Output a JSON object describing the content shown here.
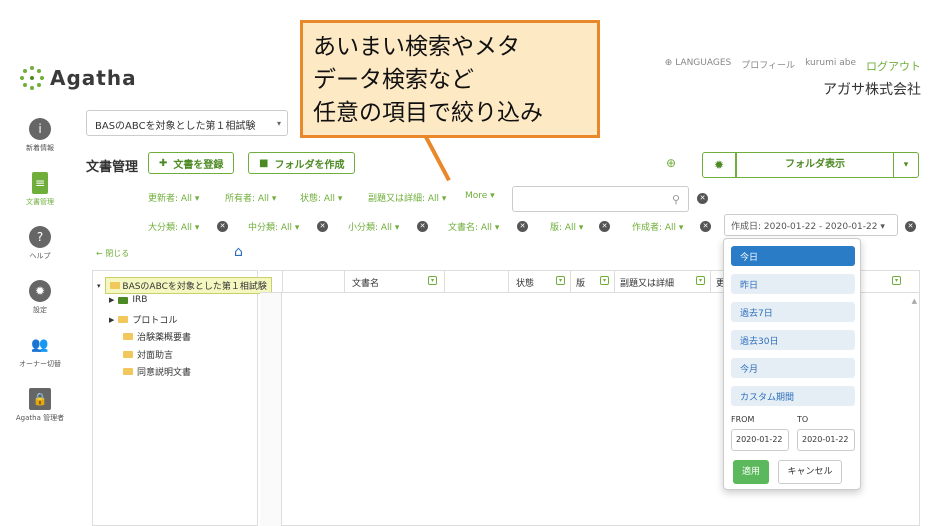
{
  "app": {
    "logo_text": "Agatha",
    "company": "アガサ株式会社"
  },
  "header": {
    "languages": "LANGUAGES",
    "profile": "プロフィール",
    "user": "kurumi abe",
    "logout": "ログアウト"
  },
  "callout": {
    "lines": [
      "あいまい検索やメタ",
      "データ検索など",
      "任意の項目で絞り込み"
    ]
  },
  "sidebar": {
    "items": [
      {
        "label": "新着情報",
        "icon": "info-icon"
      },
      {
        "label": "文書管理",
        "icon": "document-icon"
      },
      {
        "label": "ヘルプ",
        "icon": "help-icon"
      },
      {
        "label": "設定",
        "icon": "gear-icon"
      },
      {
        "label": "オーナー切替",
        "icon": "users-icon"
      },
      {
        "label": "Agatha 管理者",
        "icon": "lock-icon"
      }
    ]
  },
  "study_select": {
    "value": "BASのABCを対象とした第１相試験"
  },
  "toolbar": {
    "title": "文書管理",
    "add_doc": "文書を登録",
    "create_folder": "フォルダを作成",
    "folder_view": "フォルダ表示"
  },
  "filters_row1": [
    "更新者: All ▾",
    "所有者: All ▾",
    "状態: All ▾",
    "副題又は詳細: All ▾",
    "More ▾"
  ],
  "filters_row2": [
    "大分類: All ▾",
    "中分類: All ▾",
    "小分類: All ▾",
    "文書名: All ▾",
    "版: All ▾",
    "作成者: All ▾"
  ],
  "date_filter": "作成日: 2020-01-22 - 2020-01-22 ▾",
  "tree": {
    "back": "閉じる",
    "root": "BASのABCを対象とした第１相試験",
    "items": [
      "IRB",
      "プロトコル",
      "治験薬概要書",
      "対面助言",
      "同意説明文書"
    ]
  },
  "table": {
    "headers": [
      "文書名",
      "状態",
      "版",
      "副題又は詳細",
      "更"
    ]
  },
  "date_dropdown": {
    "ranges": [
      "今日",
      "昨日",
      "過去7日",
      "過去30日",
      "今月",
      "カスタム期間"
    ],
    "from_label": "FROM",
    "to_label": "TO",
    "from_value": "2020-01-22",
    "to_value": "2020-01-22",
    "apply": "適用",
    "cancel": "キャンセル"
  },
  "colors": {
    "brand_green": "#6fae3a",
    "callout_border": "#e8882b",
    "callout_fill": "#fde9c4",
    "link_blue": "#2a7cc7"
  }
}
